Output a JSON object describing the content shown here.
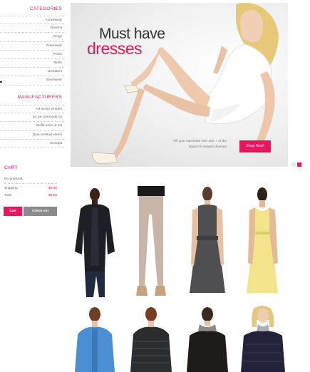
{
  "sidebar": {
    "categories_title": "CATEGORIES",
    "categories": [
      "Activewear",
      "Denims",
      "Clogs",
      "Outerwear",
      "Polos",
      "Skirts",
      "Sweaters",
      "Swimwear"
    ],
    "manufacturers_title": "MANUFACTURERS",
    "manufacturers": [
      "Ad minim veniam",
      "Ex ea commodo co",
      "Mollit anim id est",
      "Quis nostrud exerci",
      "Suscipit"
    ]
  },
  "cart": {
    "title": "CART",
    "no_products": "No products",
    "shipping_label": "Shipping",
    "shipping_value": "$0.00",
    "total_label": "Total",
    "total_value": "$0.00",
    "cart_button": "Cart",
    "checkout_button": "Check out"
  },
  "hero": {
    "heading_line1": "Must have",
    "heading_line2": "dresses",
    "subtext": "Fill your wardrobe with 250 + of the season's newest dresses",
    "shop_button": "Shop Now!"
  },
  "slider": {
    "dots": 2,
    "active": 1
  },
  "colors": {
    "accent": "#e8155f",
    "secondary_button": "#8a8a8a"
  },
  "products": [
    {
      "icon": "black-leather-jacket-image"
    },
    {
      "icon": "beige-trousers-image"
    },
    {
      "icon": "grey-dress-image"
    },
    {
      "icon": "yellow-dress-image"
    },
    {
      "icon": "blue-jacket-image"
    },
    {
      "icon": "quilted-black-jacket-image"
    },
    {
      "icon": "black-coat-image"
    },
    {
      "icon": "navy-puffer-jacket-image"
    }
  ]
}
